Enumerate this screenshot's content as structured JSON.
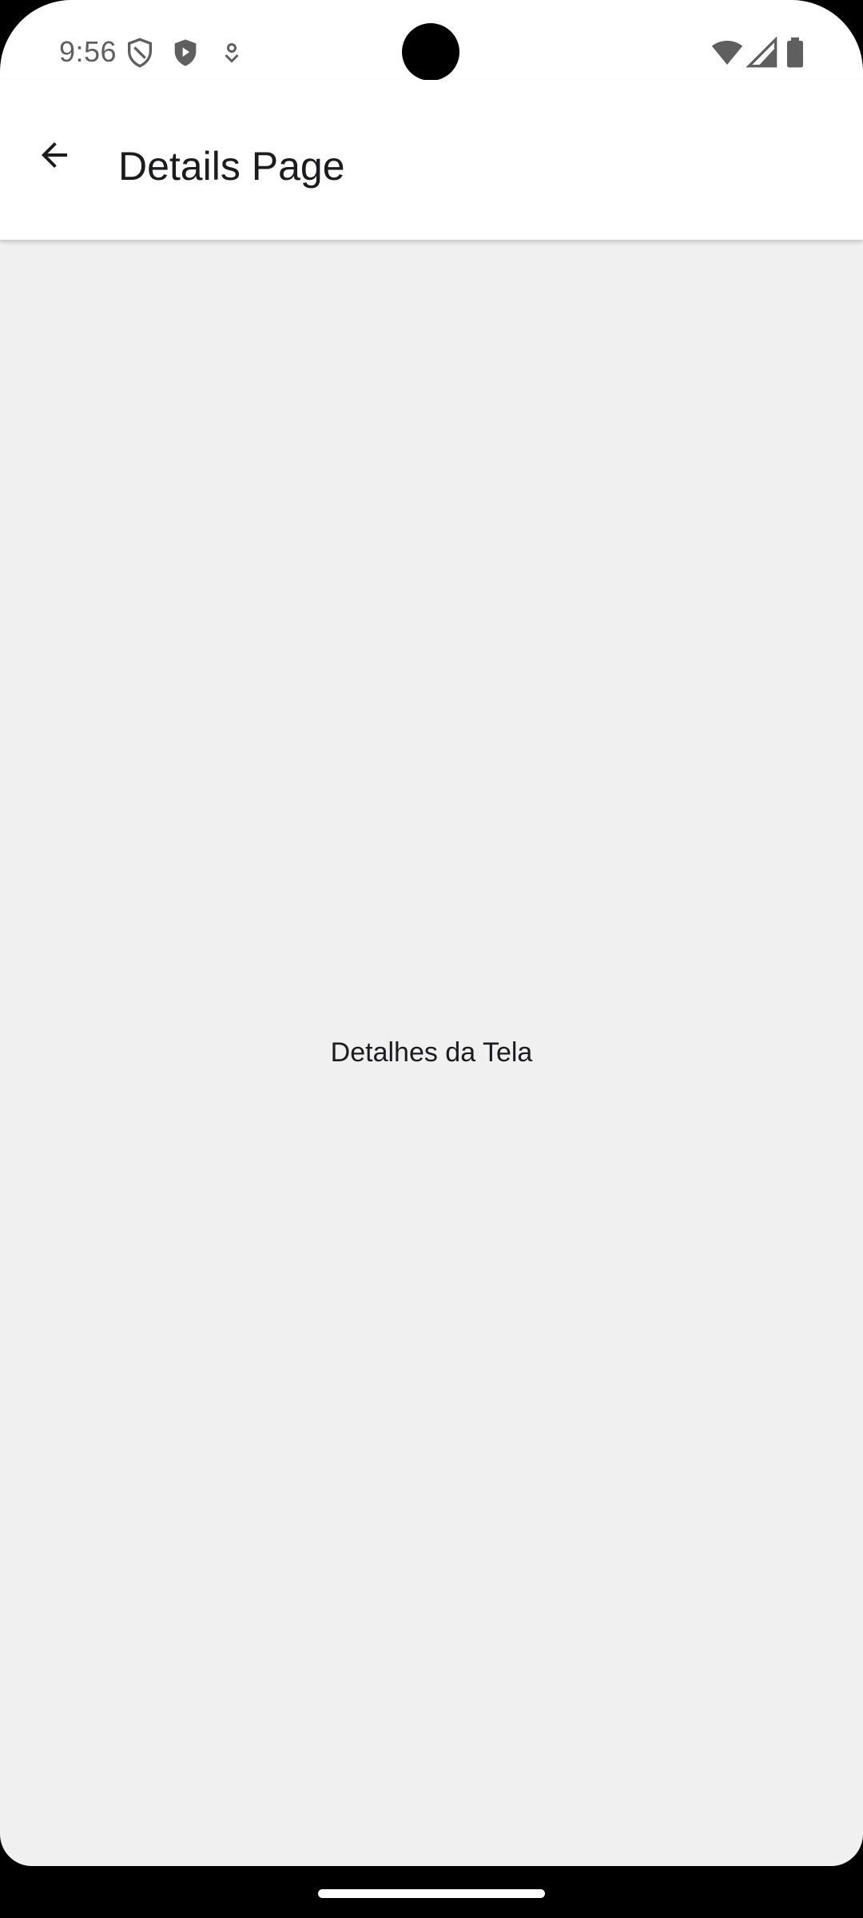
{
  "status_bar": {
    "time": "9:56",
    "left_icons": [
      "shield-outline-icon",
      "shield-play-icon",
      "location-pin-icon"
    ],
    "right_icons": [
      "wifi-icon",
      "cellular-signal-icon",
      "battery-icon"
    ]
  },
  "app_bar": {
    "title": "Details Page",
    "back_icon": "arrow-back-icon"
  },
  "content": {
    "text": "Detalhes da Tela"
  },
  "colors": {
    "background": "#f0f0f0",
    "app_bar": "#ffffff",
    "text": "#1c1b1f",
    "status_text": "#5f5f5f"
  }
}
